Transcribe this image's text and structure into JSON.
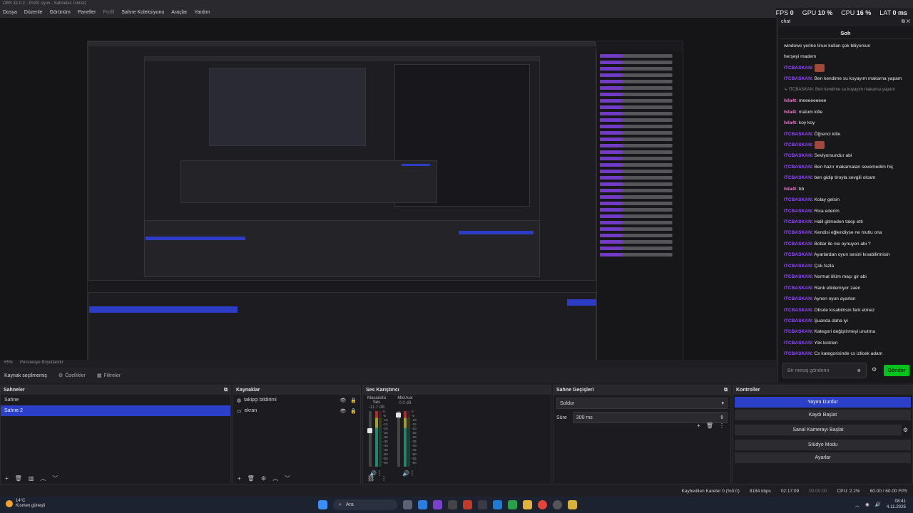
{
  "window": {
    "title": "OBS 32.0.2 - Profil: oyun - Sahneler: İsimsiz"
  },
  "menu": [
    "Dosya",
    "Düzenle",
    "Görünüm",
    "Paneller",
    "Profil",
    "Sahne Koleksiyonu",
    "Araçlar",
    "Yardım"
  ],
  "stats": {
    "fps_label": "FPS",
    "fps": "0",
    "gpu_label": "GPU",
    "gpu": "10 %",
    "cpu_label": "CPU",
    "cpu": "16 %",
    "lat_label": "LAT",
    "lat": "0 ms"
  },
  "viewbar": {
    "zoom": "65%",
    "fit": "Pencereye Boyutlandır"
  },
  "source_toolbar": {
    "title": "Kaynak seçilmemiş",
    "properties": "Özellikler",
    "filters": "Filtreler"
  },
  "scenes": {
    "title": "Sahneler",
    "items": [
      "Sahne",
      "Sahne 2"
    ],
    "selected": 1
  },
  "sources": {
    "title": "Kaynaklar",
    "items": [
      "takipçi bildirimi",
      "ekran"
    ]
  },
  "mixer": {
    "title": "Ses Karıştırıcı",
    "channels": [
      {
        "name": "Masaüstü Ses",
        "db": "-11.7 dB"
      },
      {
        "name": "Mic/Aux",
        "db": "0.0 dB"
      }
    ],
    "scale": [
      "0",
      "-5",
      "-10",
      "-15",
      "-20",
      "-25",
      "-30",
      "-35",
      "-40",
      "-45",
      "-50",
      "-55",
      "-60"
    ]
  },
  "transitions": {
    "title": "Sahne Geçişleri",
    "selected": "Soldur",
    "duration_label": "Süre",
    "duration": "300 ms"
  },
  "controls": {
    "title": "Kontroller",
    "buttons": [
      "Yayını Durdur",
      "Kaydı Başlat",
      "Sanal Kamerayı Başlat",
      "Stüdyo Modu",
      "Ayarlar"
    ]
  },
  "status": {
    "dropped": "Kaybedilen Kareler 0 (%0.0)",
    "bitrate": "8184 kbps",
    "stream_time": "02:17:09",
    "rec_time": "00:00:00",
    "cpu": "CPU: 2.2%",
    "fps": "60.00 / 60.00 FPS"
  },
  "chat": {
    "panel_title": "chat",
    "title": "Soh",
    "messages": [
      {
        "user": "",
        "text": "windows yerine linux kullan çok biliyorsun",
        "cls": ""
      },
      {
        "user": "",
        "text": "herşeyi madem",
        "cls": ""
      },
      {
        "user": "ITCBASKAN",
        "text": "",
        "cls": "u1",
        "emote": true
      },
      {
        "user": "ITCBASKAN",
        "text": "Ben kendime su koyayım makarna yapam",
        "cls": "u1"
      },
      {
        "user": "",
        "text": "↳ ITCBASKAN: Ben kendime su koyayım makarna yapam",
        "cls": "reply"
      },
      {
        "user": "hila4t",
        "text": "meeeeeeeee",
        "cls": "u2"
      },
      {
        "user": "hila4t",
        "text": "malum kitle",
        "cls": "u2"
      },
      {
        "user": "hila4t",
        "text": "koy koy",
        "cls": "u2"
      },
      {
        "user": "ITCBASKAN",
        "text": "Öğrenci kitle",
        "cls": "u1"
      },
      {
        "user": "ITCBASKAN",
        "text": "",
        "cls": "u1",
        "emote": true
      },
      {
        "user": "ITCBASKAN",
        "text": "Seviyorsundur abi",
        "cls": "u1"
      },
      {
        "user": "ITCBASKAN",
        "text": "Ben hazır makarnaları sevemedim hiç",
        "cls": "u1"
      },
      {
        "user": "ITCBASKAN",
        "text": "ben gidip tiroyla sevgili olcam",
        "cls": "u1"
      },
      {
        "user": "hila4t",
        "text": "bb",
        "cls": "u2"
      },
      {
        "user": "ITCBASKAN",
        "text": "Kolay gelsin",
        "cls": "u1"
      },
      {
        "user": "ITCBASKAN",
        "text": "Rica ederim",
        "cls": "u1"
      },
      {
        "user": "ITCBASKAN",
        "text": "Halil gitmeden takip etti",
        "cls": "u1"
      },
      {
        "user": "ITCBASKAN",
        "text": "Kendisi eğlendiyse ne mutlu ona",
        "cls": "u1"
      },
      {
        "user": "ITCBASKAN",
        "text": "Botlar ile nie oynuyon abi ?",
        "cls": "u1"
      },
      {
        "user": "ITCBASKAN",
        "text": "Ayarlardan oyun sesini kısabilirmisin",
        "cls": "u1"
      },
      {
        "user": "ITCBASKAN",
        "text": "Çok fazla",
        "cls": "u1"
      },
      {
        "user": "ITCBASKAN",
        "text": "Normal ölüm maçı gir abi",
        "cls": "u1"
      },
      {
        "user": "ITCBASKAN",
        "text": "Rank etkilemiyor zaen",
        "cls": "u1"
      },
      {
        "user": "ITCBASKAN",
        "text": "Aynen oyun ayarları",
        "cls": "u1"
      },
      {
        "user": "ITCBASKAN",
        "text": "Obsde kısabilirsin fark etmez",
        "cls": "u1"
      },
      {
        "user": "ITCBASKAN",
        "text": "Şuanda daha iyi",
        "cls": "u1"
      },
      {
        "user": "ITCBASKAN",
        "text": "Kategori değiştirmeyi unutma",
        "cls": "u1"
      },
      {
        "user": "ITCBASKAN",
        "text": "Yok kickten",
        "cls": "u1"
      },
      {
        "user": "ITCBASKAN",
        "text": "Cs kategorisinde cs izlicek adam",
        "cls": "u1"
      },
      {
        "user": "ITCBASKAN",
        "text": "Onun karışına çıkarsın",
        "cls": "u1"
      }
    ],
    "input_placeholder": "Bir mesaj gönderin",
    "send": "Gönder"
  },
  "taskbar": {
    "weather_temp": "14°C",
    "weather_desc": "Kısmen güneşli",
    "search": "Ara",
    "time": "08:41",
    "date": "4.11.2025"
  }
}
